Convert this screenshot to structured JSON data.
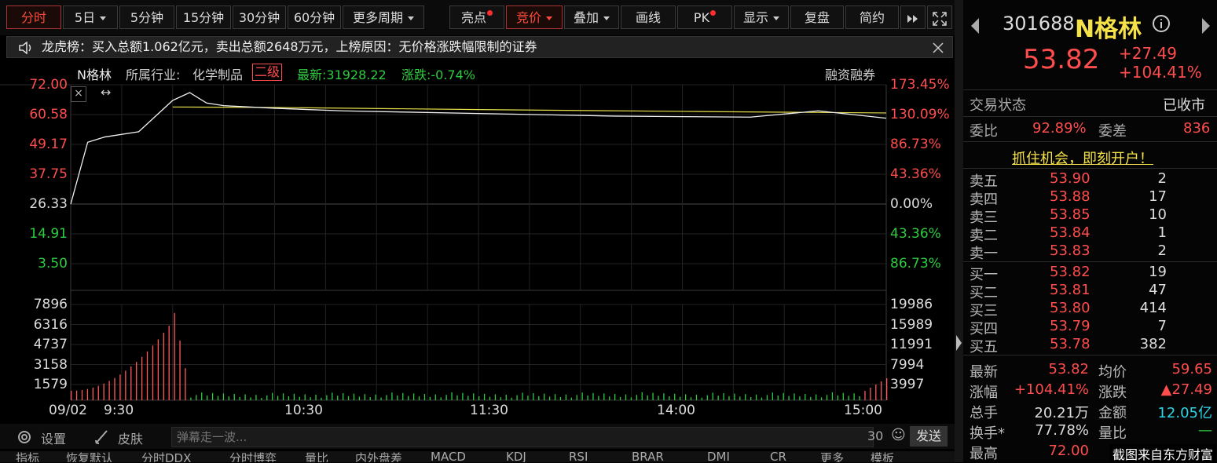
{
  "toolbar": {
    "tabs": [
      "分时",
      "5日",
      "5分钟",
      "15分钟",
      "30分钟",
      "60分钟",
      "更多周期"
    ],
    "tools": [
      "亮点",
      "竞价",
      "叠加",
      "画线",
      "PK",
      "显示",
      "复盘",
      "简约"
    ]
  },
  "notice": {
    "text": "龙虎榜：买入总额1.062亿元，卖出总额2648万元，上榜原因：无价格涨跌幅限制的证券"
  },
  "chart": {
    "name": "N格林",
    "industry_label": "所属行业:",
    "industry": "化学制品",
    "level": "二级",
    "latest": "最新:31928.22",
    "change": "涨跌:-0.74%",
    "margin": "融资融券",
    "left_ticks": [
      "72.00",
      "60.58",
      "49.17",
      "37.75",
      "26.33",
      "14.91",
      "3.50"
    ],
    "right_ticks": [
      "173.45%",
      "130.09%",
      "86.73%",
      "43.36%",
      "0.00%",
      "43.36%",
      "86.73%"
    ],
    "vol_left_ticks": [
      "7896",
      "6316",
      "4737",
      "3158",
      "1579"
    ],
    "vol_right_ticks": [
      "19986",
      "15989",
      "11991",
      "7994",
      "3997"
    ],
    "time_ticks": [
      "09/02",
      "9:30",
      "10:30",
      "11:30",
      "14:00",
      "15:00"
    ]
  },
  "chart_data": {
    "type": "line",
    "series": [
      {
        "name": "price",
        "x": [
          0,
          5,
          10,
          20,
          30,
          35,
          40,
          45,
          60,
          80,
          100,
          120,
          140,
          160,
          180,
          200,
          220,
          240
        ],
        "y": [
          26.3,
          50,
          52,
          54,
          66,
          69,
          65,
          64,
          63,
          62,
          61.5,
          61,
          60.5,
          60,
          59.8,
          59.6,
          62,
          59.2
        ]
      },
      {
        "name": "avg",
        "x": [
          30,
          60,
          120,
          180,
          240
        ],
        "y": [
          63.5,
          63.3,
          62.5,
          61.8,
          61.2
        ]
      }
    ],
    "ylim": [
      3.5,
      72.0
    ]
  },
  "bottom": {
    "settings": "设置",
    "skin": "皮肤",
    "danmu_placeholder": "弹幕走一波...",
    "count": "30",
    "send": "发送",
    "tabs": [
      "指标",
      "恢复默认",
      "分时DDX",
      "分时博弈",
      "量比",
      "内外盘差",
      "MACD",
      "KDJ",
      "RSI",
      "BRAR",
      "DMI",
      "CR",
      "更多",
      "模板"
    ]
  },
  "panel": {
    "code": "301688",
    "name": "N格林",
    "price": "53.82",
    "change": "+27.49",
    "change_pct": "+104.41%",
    "status_label": "交易状态",
    "status": "已收市",
    "wb_label": "委比",
    "wb": "92.89%",
    "wc_label": "委差",
    "wc": "836",
    "promo": "抓住机会，即刻开户！",
    "asks": [
      {
        "label": "卖五",
        "price": "53.90",
        "vol": "2"
      },
      {
        "label": "卖四",
        "price": "53.88",
        "vol": "17"
      },
      {
        "label": "卖三",
        "price": "53.85",
        "vol": "10"
      },
      {
        "label": "卖二",
        "price": "53.84",
        "vol": "1"
      },
      {
        "label": "卖一",
        "price": "53.83",
        "vol": "2"
      }
    ],
    "bids": [
      {
        "label": "买一",
        "price": "53.82",
        "vol": "19"
      },
      {
        "label": "买二",
        "price": "53.81",
        "vol": "47"
      },
      {
        "label": "买三",
        "price": "53.80",
        "vol": "414"
      },
      {
        "label": "买四",
        "price": "53.79",
        "vol": "7"
      },
      {
        "label": "买五",
        "price": "53.78",
        "vol": "382"
      }
    ],
    "stats": [
      [
        "最新",
        "53.82",
        "均价",
        "59.65"
      ],
      [
        "涨幅",
        "+104.41%",
        "涨跌",
        "▲27.49"
      ],
      [
        "总手",
        "20.21万",
        "金额",
        "12.05亿"
      ],
      [
        "换手*",
        "77.78%",
        "量比",
        "—"
      ],
      [
        "最高",
        "72.00",
        "",
        ""
      ]
    ],
    "watermark": "截图来自东方财富"
  }
}
